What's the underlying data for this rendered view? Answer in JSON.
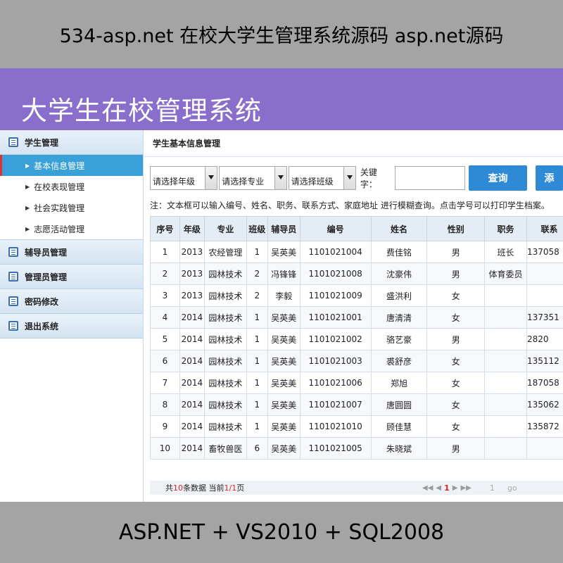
{
  "top_banner": "534-asp.net 在校大学生管理系统源码 asp.net源码",
  "bottom_banner": "ASP.NET + VS2010 + SQL2008",
  "header": {
    "title": "大学生在校管理系统"
  },
  "sidebar": {
    "groups": [
      {
        "label": "学生管理",
        "icon": "list-icon"
      },
      {
        "label": "辅导员管理",
        "icon": "list-icon"
      },
      {
        "label": "管理员管理",
        "icon": "list-icon"
      },
      {
        "label": "密码修改",
        "icon": "list-icon"
      },
      {
        "label": "退出系统",
        "icon": "list-icon"
      }
    ],
    "submenu": [
      {
        "label": "基本信息管理",
        "active": true
      },
      {
        "label": "在校表现管理"
      },
      {
        "label": "社会实践管理"
      },
      {
        "label": "志愿活动管理"
      }
    ]
  },
  "content": {
    "breadcrumb": "学生基本信息管理",
    "filters": {
      "grade": "请选择年级",
      "major": "请选择专业",
      "class": "请选择班级",
      "keyword_label": "关键字：",
      "keyword_value": "",
      "query_button": "查询",
      "more_button": "添"
    },
    "note": "注：文本框可以输入编号、姓名、职务、联系方式、家庭地址 进行模糊查询。点击学号可以打印学生档案。",
    "table": {
      "columns": [
        "序号",
        "年级",
        "专业",
        "班级",
        "辅导员",
        "编号",
        "姓名",
        "性别",
        "职务",
        "联系"
      ],
      "rows": [
        [
          "1",
          "2013",
          "农经管理",
          "1",
          "吴英美",
          "1101021004",
          "费佳铭",
          "男",
          "班长",
          "137058"
        ],
        [
          "2",
          "2013",
          "园林技术",
          "2",
          "冯锋锋",
          "1101021008",
          "沈豪伟",
          "男",
          "体育委员",
          ""
        ],
        [
          "3",
          "2013",
          "园林技术",
          "2",
          "李毅",
          "1101021009",
          "盛洪利",
          "女",
          "",
          ""
        ],
        [
          "4",
          "2014",
          "园林技术",
          "1",
          "吴英美",
          "1101021001",
          "唐清清",
          "女",
          "",
          "137351"
        ],
        [
          "5",
          "2014",
          "园林技术",
          "1",
          "吴英美",
          "1101021002",
          "骆艺豪",
          "男",
          "",
          "2820"
        ],
        [
          "6",
          "2014",
          "园林技术",
          "1",
          "吴英美",
          "1101021003",
          "裘舒彦",
          "女",
          "",
          "135112"
        ],
        [
          "7",
          "2014",
          "园林技术",
          "1",
          "吴英美",
          "1101021006",
          "郑旭",
          "女",
          "",
          "187058"
        ],
        [
          "8",
          "2014",
          "园林技术",
          "1",
          "吴英美",
          "1101021007",
          "唐圆圆",
          "女",
          "",
          "135062"
        ],
        [
          "9",
          "2014",
          "园林技术",
          "1",
          "吴英美",
          "1101021010",
          "顾佳慧",
          "女",
          "",
          "135872"
        ],
        [
          "10",
          "2014",
          "畜牧兽医",
          "6",
          "吴英美",
          "1101021005",
          "朱晓斌",
          "男",
          "",
          ""
        ]
      ]
    },
    "pager": {
      "prefix": "共",
      "total": "10",
      "mid": "条数据 当前",
      "current": "1/1",
      "suffix": "页",
      "first_icon": "◀◀",
      "prev_icon": "◀",
      "page": "1",
      "next_icon": "▶",
      "last_icon": "▶▶",
      "page_input": "1",
      "go": "go"
    }
  }
}
